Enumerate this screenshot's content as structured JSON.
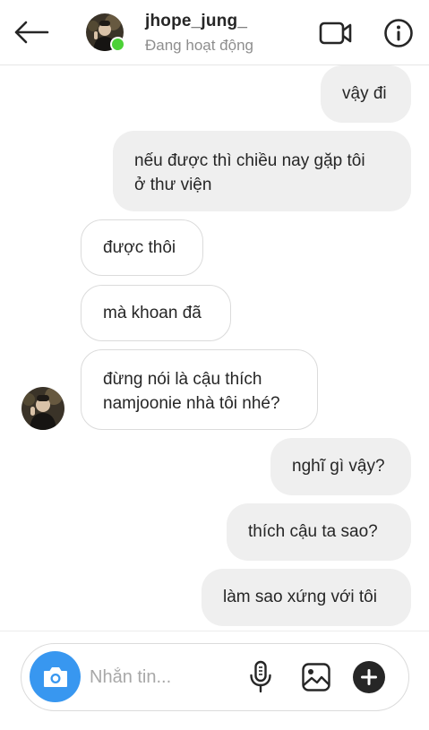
{
  "header": {
    "username": "jhope_jung_",
    "status": "Đang hoạt động",
    "back_icon": "arrow-left-icon",
    "video_icon": "video-camera-icon",
    "info_icon": "info-icon",
    "online_color": "#4cd137"
  },
  "messages": [
    {
      "direction": "sent",
      "text": "vậy đi"
    },
    {
      "direction": "sent",
      "text": "nếu được thì chiều nay gặp tôi\nở thư viện"
    },
    {
      "direction": "received",
      "text": "được thôi"
    },
    {
      "direction": "received",
      "text": "mà khoan đã"
    },
    {
      "direction": "received",
      "text": "đừng nói là cậu thích\nnamjoonie nhà tôi nhé?"
    },
    {
      "direction": "sent",
      "text": "nghĩ gì vậy?"
    },
    {
      "direction": "sent",
      "text": "thích cậu ta sao?"
    },
    {
      "direction": "sent",
      "text": "làm sao xứng với tôi"
    }
  ],
  "composer": {
    "placeholder": "Nhắn tin...",
    "camera_icon": "camera-icon",
    "mic_icon": "microphone-icon",
    "gallery_icon": "image-icon",
    "plus_icon": "plus-circle-icon",
    "accent_color": "#3897f0"
  },
  "colors": {
    "sent_bubble": "#efefef",
    "received_border": "#dbdbdb",
    "muted_text": "#8e8e8e"
  }
}
